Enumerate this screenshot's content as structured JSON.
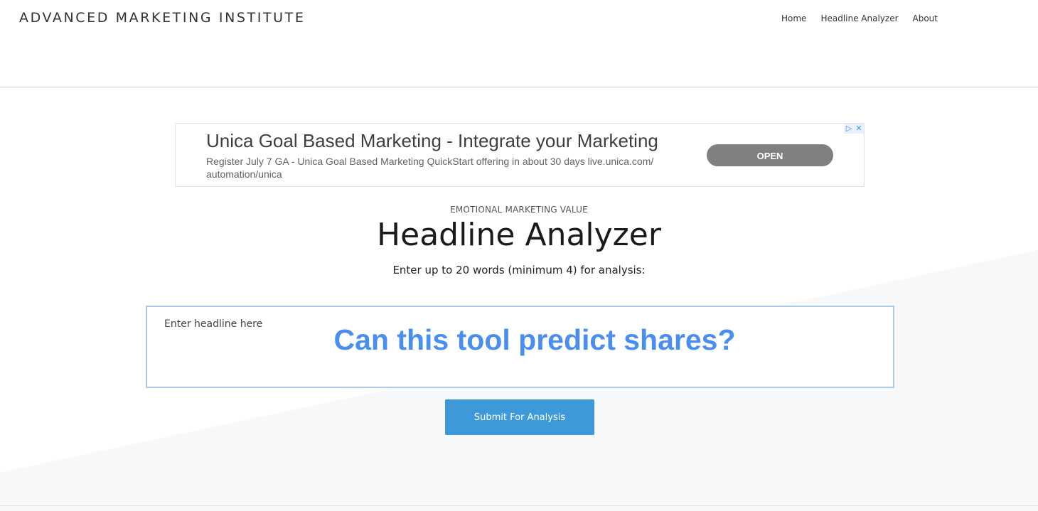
{
  "header": {
    "logo": "ADVANCED MARKETING INSTITUTE",
    "nav": [
      {
        "label": "Home"
      },
      {
        "label": "Headline Analyzer"
      },
      {
        "label": "About"
      }
    ]
  },
  "ad": {
    "title": "Unica Goal Based Marketing - Integrate your Marketing",
    "description": "Register July 7 GA - Unica Goal Based Marketing QuickStart offering in about 30 days live.unica.com/ automation/unica",
    "cta": "OPEN",
    "adchoices_icon": "adchoices-icon",
    "close_icon": "close-icon"
  },
  "main": {
    "eyebrow": "EMOTIONAL MARKETING VALUE",
    "title": "Headline Analyzer",
    "instructions": "Enter up to 20 words (minimum 4) for analysis:",
    "input_placeholder": "Enter headline here",
    "overlay_caption": "Can this tool predict shares?",
    "submit_label": "Submit For Analysis"
  },
  "colors": {
    "accent": "#3d99d8",
    "overlay_text": "#4a8ef2",
    "input_border": "#a9cbe8",
    "ad_button": "#808080"
  }
}
